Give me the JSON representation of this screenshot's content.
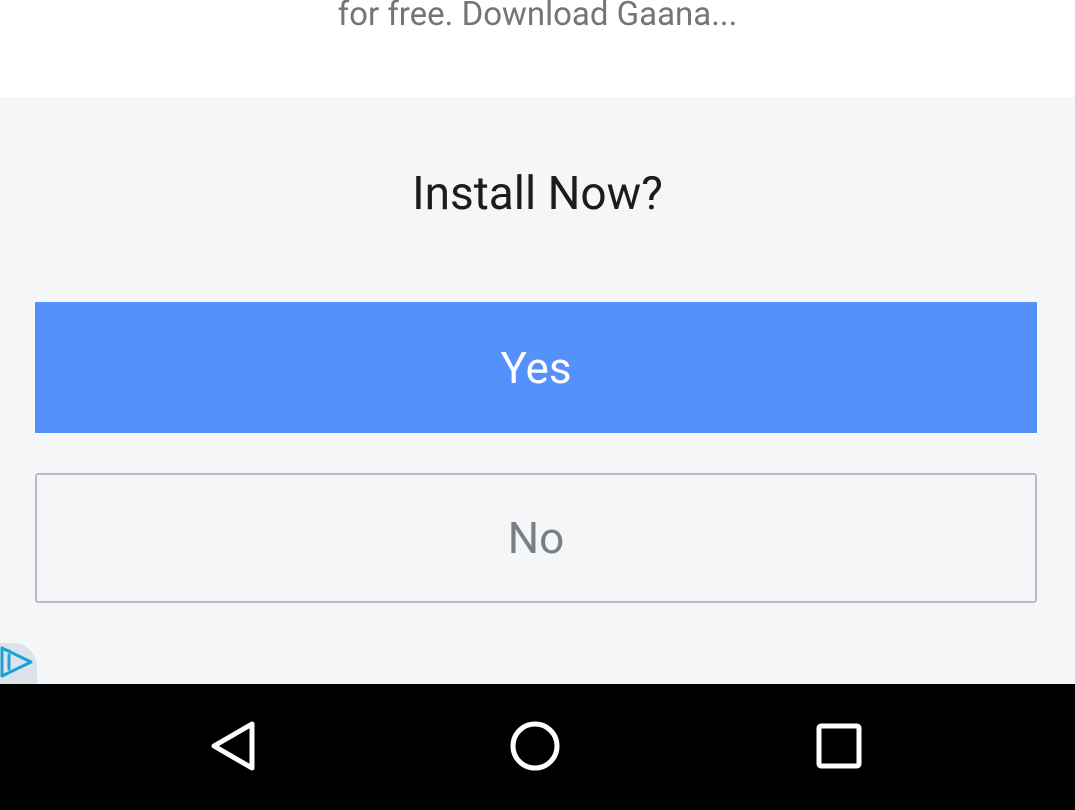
{
  "ad": {
    "description": "for free. Download Gaana...",
    "prompt_title": "Install Now?",
    "yes_label": "Yes",
    "no_label": "No",
    "ad_choices_icon": "ad-choices-play-icon",
    "colors": {
      "yes_button": "#5591fb",
      "panel_background": "#f4f6f8",
      "no_button_border": "#b8bcc2",
      "ad_choices_accent": "#1aa3d9"
    }
  },
  "navbar": {
    "back_icon": "triangle-back-icon",
    "home_icon": "circle-home-icon",
    "recents_icon": "square-recents-icon",
    "background": "#000000"
  }
}
